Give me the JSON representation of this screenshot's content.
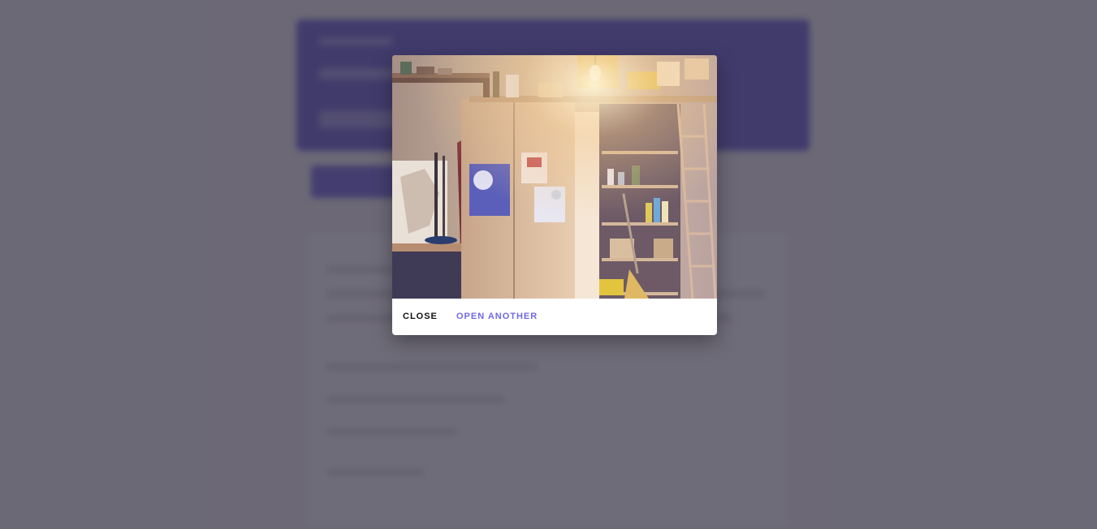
{
  "modal": {
    "close_label": "CLOSE",
    "open_another_label": "OPEN ANOTHER"
  },
  "colors": {
    "overlay": "#3c3848",
    "accent": "#6f69e6",
    "hero": "#4f46c8"
  },
  "icons": {
    "image": "storage-room-illustration"
  }
}
